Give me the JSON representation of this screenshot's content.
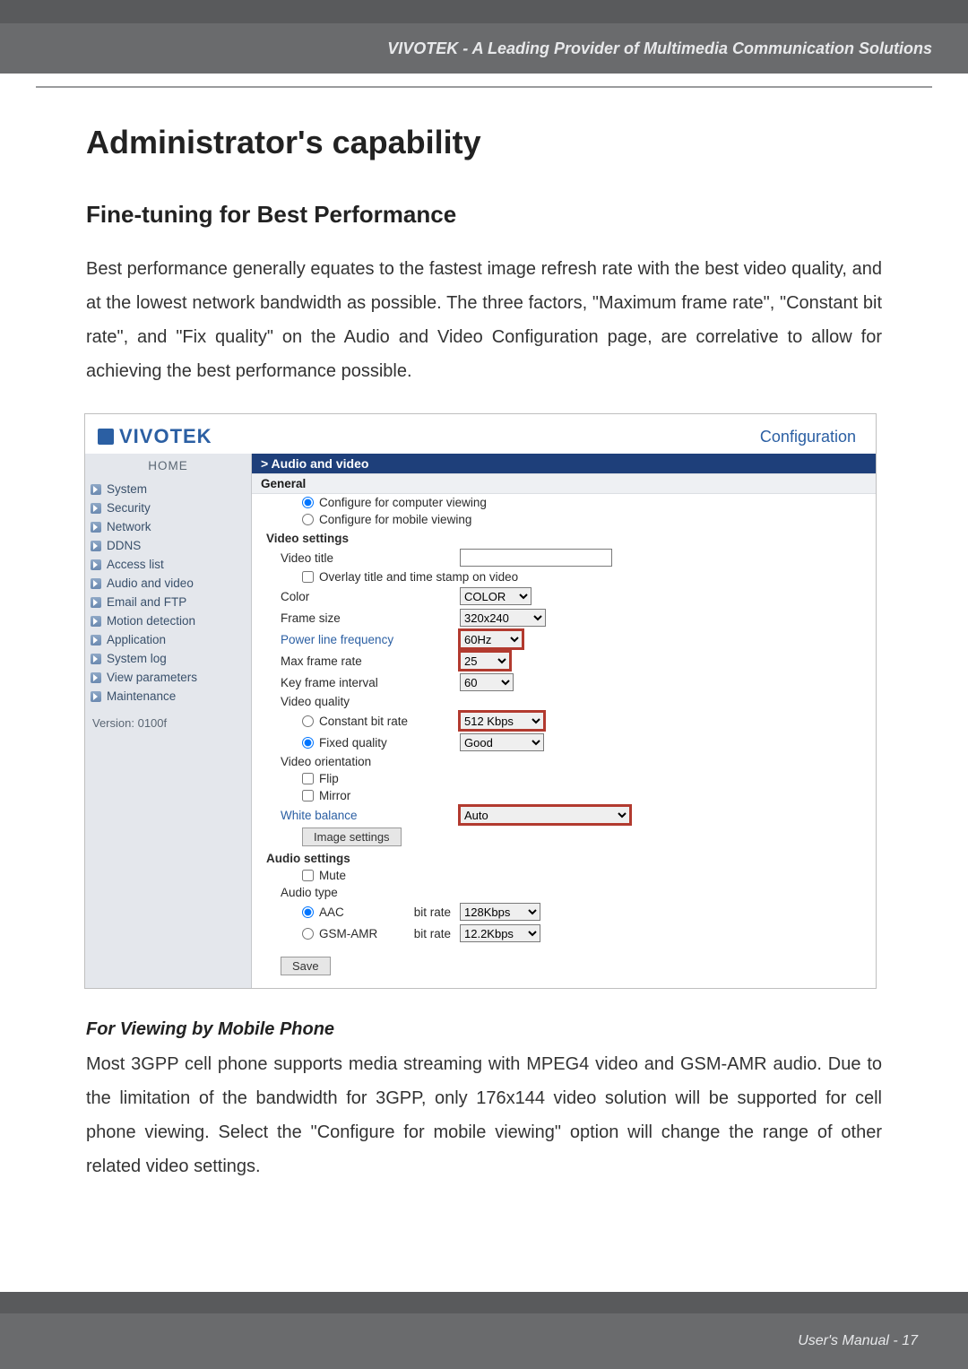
{
  "header": {
    "tagline": "VIVOTEK - A Leading Provider of Multimedia Communication Solutions"
  },
  "doc": {
    "h1": "Administrator's capability",
    "h2": "Fine-tuning for Best Performance",
    "p1": "Best performance generally equates to the fastest image refresh rate with the best video quality, and at the lowest network bandwidth as possible. The three factors, \"Maximum frame rate\", \"Constant bit rate\", and \"Fix quality\" on the Audio and Video Configuration page, are correlative to allow for achieving the best performance possible.",
    "sub": "For Viewing by Mobile Phone",
    "p2": "Most 3GPP cell phone supports media streaming with MPEG4 video and GSM-AMR audio. Due to the limitation of the bandwidth for 3GPP, only 176x144 video solution will be supported for cell phone viewing. Select the \"Configure for mobile viewing\" option will change the range of other related video settings."
  },
  "shot": {
    "logo": "VIVOTEK",
    "conf": "Configuration",
    "sidebar": {
      "home": "HOME",
      "items": [
        "System",
        "Security",
        "Network",
        "DDNS",
        "Access list",
        "Audio and video",
        "Email and FTP",
        "Motion detection",
        "Application",
        "System log",
        "View parameters",
        "Maintenance"
      ],
      "version": "Version: 0100f"
    },
    "crumb": "> Audio and video",
    "general": {
      "title": "General",
      "opt_computer": "Configure for computer viewing",
      "opt_mobile": "Configure for mobile viewing"
    },
    "video": {
      "title": "Video settings",
      "videotitle_lbl": "Video title",
      "videotitle_val": "",
      "overlay": "Overlay title and time stamp on video",
      "color_lbl": "Color",
      "color_val": "COLOR",
      "framesize_lbl": "Frame size",
      "framesize_val": "320x240",
      "powerline_lbl": "Power line frequency",
      "powerline_val": "60Hz",
      "maxframe_lbl": "Max frame rate",
      "maxframe_val": "25",
      "keyframe_lbl": "Key frame interval",
      "keyframe_val": "60",
      "quality_lbl": "Video quality",
      "constbit_lbl": "Constant bit rate",
      "constbit_val": "512 Kbps",
      "fixed_lbl": "Fixed quality",
      "fixed_val": "Good",
      "orient_lbl": "Video orientation",
      "flip": "Flip",
      "mirror": "Mirror",
      "white_lbl": "White balance",
      "white_val": "Auto",
      "imgset_btn": "Image settings"
    },
    "audio": {
      "title": "Audio settings",
      "mute": "Mute",
      "type_lbl": "Audio type",
      "aac": "AAC",
      "aac_rate_lbl": "bit rate",
      "aac_rate_val": "128Kbps",
      "gsm": "GSM-AMR",
      "gsm_rate_lbl": "bit rate",
      "gsm_rate_val": "12.2Kbps"
    },
    "save": "Save"
  },
  "footer": {
    "pg": "User's Manual - 17"
  }
}
